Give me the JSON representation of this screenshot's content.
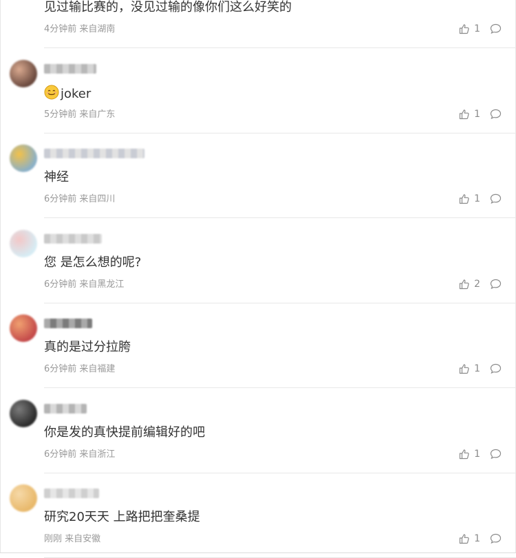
{
  "comments": [
    {
      "text": "见过输比赛的，没见过输的像你们这么好笑的",
      "time": "4分钟前",
      "location": "来自湖南",
      "likes": "1",
      "avatar_colors": [
        "#cfcfcf",
        "#e0e0e0"
      ],
      "username_colors": [
        "#d8d8d8",
        "#c8c8c8"
      ]
    },
    {
      "text": "joker",
      "emoji": "smiling-face-emoji",
      "time": "5分钟前",
      "location": "来自广东",
      "likes": "1",
      "avatar_colors": [
        "#6b4a3f",
        "#d9a98f"
      ],
      "username_colors": [
        "#b8b8b8",
        "#d5d5d5"
      ]
    },
    {
      "text": "神经",
      "time": "6分钟前",
      "location": "来自四川",
      "likes": "1",
      "avatar_colors": [
        "#8ab0c8",
        "#f2c14a"
      ],
      "username_colors": [
        "#c9ccd4",
        "#e2e2e2"
      ]
    },
    {
      "text": "您 是怎么想的呢?",
      "time": "6分钟前",
      "location": "来自黑龙江",
      "likes": "2",
      "avatar_colors": [
        "#d6ecf4",
        "#f3c7c7"
      ],
      "username_colors": [
        "#c9c9c9",
        "#dedede"
      ]
    },
    {
      "text": "真的是过分拉胯",
      "time": "6分钟前",
      "location": "来自福建",
      "likes": "1",
      "avatar_colors": [
        "#c44a4a",
        "#f0a070"
      ],
      "username_colors": [
        "#a9a9a9",
        "#7b7b7b"
      ]
    },
    {
      "text": "你是发的真快提前编辑好的吧",
      "time": "6分钟前",
      "location": "来自浙江",
      "likes": "1",
      "avatar_colors": [
        "#2b2b2b",
        "#7a7a7a"
      ],
      "username_colors": [
        "#b4b4b4",
        "#d9d9d9"
      ]
    },
    {
      "text": "研究20天天 上路把把奎桑提",
      "time": "刚刚",
      "location": "来自安徽",
      "likes": "1",
      "avatar_colors": [
        "#e8b86a",
        "#f6d9a8"
      ],
      "username_colors": [
        "#cfcfcf",
        "#e6e6e6"
      ]
    }
  ],
  "colors": {
    "meta_text": "#999999",
    "body_text": "#333333",
    "icon": "#8a8a8a",
    "divider": "#e8e8e8"
  },
  "icons": {
    "like": "thumbs-up-icon",
    "reply": "comment-bubble-icon"
  }
}
